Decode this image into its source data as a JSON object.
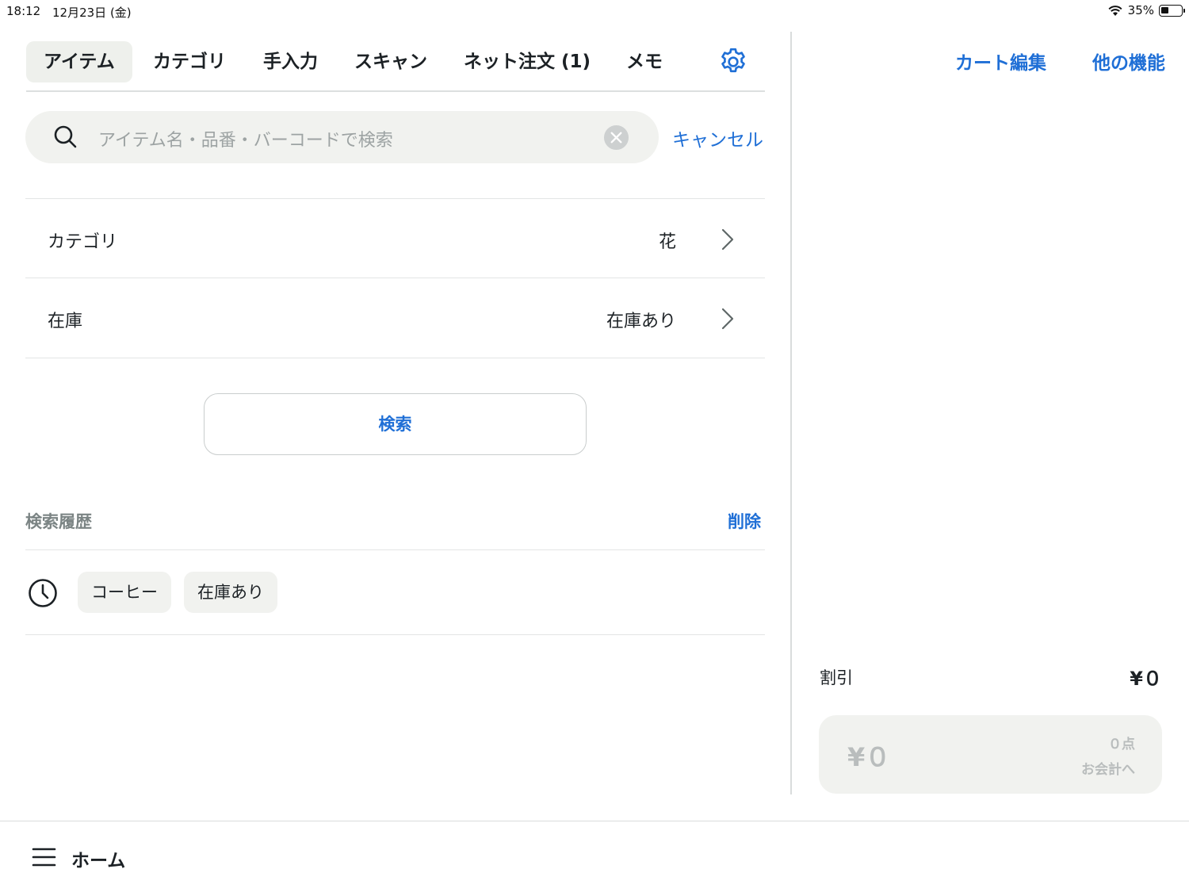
{
  "status_bar": {
    "time": "18:12",
    "date": "12月23日 (金)",
    "battery": "35%"
  },
  "tabs": [
    {
      "label": "アイテム"
    },
    {
      "label": "カテゴリ"
    },
    {
      "label": "手入力"
    },
    {
      "label": "スキャン"
    },
    {
      "label": "ネット注文 (1)"
    },
    {
      "label": "メモ"
    }
  ],
  "active_tab": "アイテム",
  "search": {
    "placeholder": "アイテム名・品番・バーコードで検索",
    "value": "",
    "cancel_label": "キャンセル"
  },
  "filters": [
    {
      "label": "カテゴリ",
      "value": "花"
    },
    {
      "label": "在庫",
      "value": "在庫あり"
    }
  ],
  "search_button_label": "検索",
  "history": {
    "title": "検索履歴",
    "delete_label": "削除",
    "chips": [
      "コーヒー",
      "在庫あり"
    ]
  },
  "cart": {
    "edit_label": "カート編集",
    "more_label": "他の機能",
    "discount_label": "割引",
    "discount_value": "¥０",
    "total": "¥０",
    "count": "０点",
    "checkout_label": "お会計へ"
  },
  "bottom": {
    "home_label": "ホーム"
  },
  "colors": {
    "accent": "#1f6fd6",
    "chip_bg": "#f1f2ef",
    "text": "#1c2125"
  }
}
